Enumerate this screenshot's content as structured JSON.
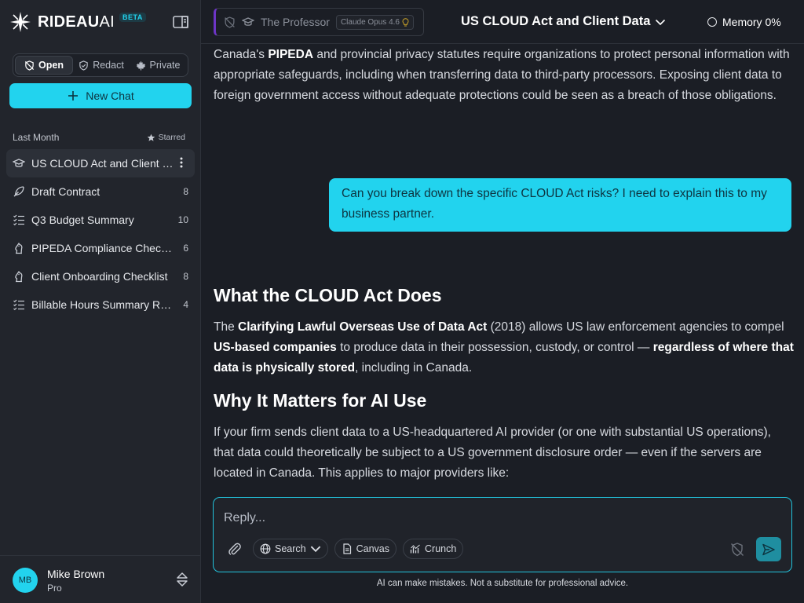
{
  "brand": {
    "name": "RIDEAU",
    "suffix": "AI",
    "badge": "BETA"
  },
  "modes": [
    {
      "label": "Open",
      "active": true
    },
    {
      "label": "Redact",
      "active": false
    },
    {
      "label": "Private",
      "active": false
    }
  ],
  "new_chat_label": "New Chat",
  "sidebar": {
    "section_label": "Last Month",
    "starred_label": "Starred",
    "chats": [
      {
        "label": "US CLOUD Act and Client Data",
        "count": "",
        "icon": "graduation-cap-icon",
        "active": true
      },
      {
        "label": "Draft Contract",
        "count": "8",
        "icon": "feather-pen-icon",
        "active": false
      },
      {
        "label": "Q3 Budget Summary",
        "count": "10",
        "icon": "checklist-icon",
        "active": false
      },
      {
        "label": "PIPEDA Compliance Checklist",
        "count": "6",
        "icon": "chess-knight-icon",
        "active": false
      },
      {
        "label": "Client Onboarding Checklist",
        "count": "8",
        "icon": "chess-knight-icon",
        "active": false
      },
      {
        "label": "Billable Hours Summary Report",
        "count": "4",
        "icon": "checklist-icon",
        "active": false
      }
    ]
  },
  "user": {
    "initials": "MB",
    "name": "Mike Brown",
    "plan": "Pro"
  },
  "header": {
    "persona": "The Professor",
    "model": "Claude Opus 4.6",
    "title": "US CLOUD Act and Client Data",
    "memory_label": "Memory 0%"
  },
  "messages": {
    "intro_parts": [
      {
        "text": "Canada's ",
        "bold": false
      },
      {
        "text": "PIPEDA",
        "bold": true
      },
      {
        "text": " and provincial privacy statutes require organizations to protect personal information with appropriate safeguards, including when transferring data to third-party processors. Exposing client data to foreign government access without adequate protections could be seen as a breach of those obligations.",
        "bold": false
      }
    ],
    "user_question": "Can you break down the specific CLOUD Act risks? I need to explain this to my business partner.",
    "heading1": "What the CLOUD Act Does",
    "para1_parts": [
      {
        "text": "The ",
        "bold": false
      },
      {
        "text": "Clarifying Lawful Overseas Use of Data Act",
        "bold": true
      },
      {
        "text": " (2018) allows US law enforcement agencies to compel ",
        "bold": false
      },
      {
        "text": "US-based companies",
        "bold": true
      },
      {
        "text": " to produce data in their possession, custody, or control — ",
        "bold": false
      },
      {
        "text": "regardless of where that data is physically stored",
        "bold": true
      },
      {
        "text": ", including in Canada.",
        "bold": false
      }
    ],
    "heading2": "Why It Matters for AI Use",
    "para2": "If your firm sends client data to a US-headquartered AI provider (or one with substantial US operations), that data could theoretically be subject to a US government disclosure order — even if the servers are located in Canada. This applies to major providers like:"
  },
  "composer": {
    "placeholder": "Reply...",
    "tools": [
      {
        "label": "Search",
        "icon": "globe-icon",
        "dropdown": true
      },
      {
        "label": "Canvas",
        "icon": "document-icon",
        "dropdown": false
      },
      {
        "label": "Crunch",
        "icon": "bar-chart-icon",
        "dropdown": false
      }
    ]
  },
  "disclaimer": "AI can make mistakes. Not a substitute for professional advice.",
  "colors": {
    "accent": "#22d3ee",
    "background": "#1b1e25",
    "sidebar": "#22252c",
    "persona_bar": "#6d35c6"
  }
}
